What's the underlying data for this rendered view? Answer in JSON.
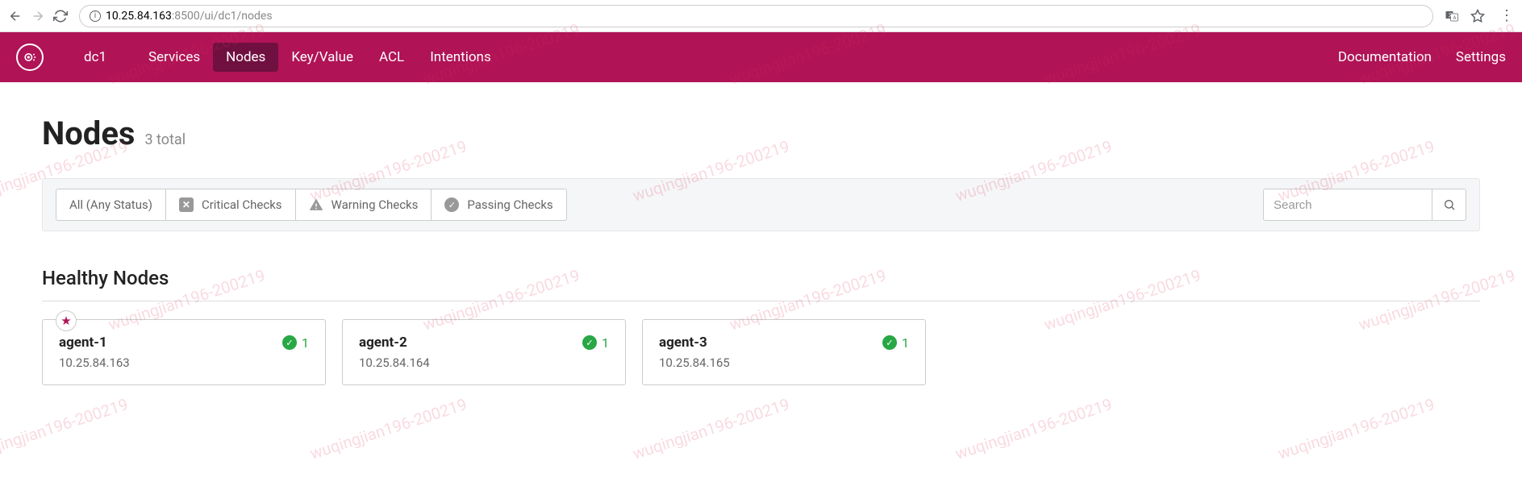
{
  "browser": {
    "url_host": "10.25.84.163",
    "url_path": ":8500/ui/dc1/nodes"
  },
  "nav": {
    "datacenter": "dc1",
    "items": [
      "Services",
      "Nodes",
      "Key/Value",
      "ACL",
      "Intentions"
    ],
    "active": "Nodes",
    "right": [
      "Documentation",
      "Settings"
    ]
  },
  "page": {
    "title": "Nodes",
    "subtitle": "3 total"
  },
  "filters": {
    "all": "All (Any Status)",
    "critical": "Critical Checks",
    "warning": "Warning Checks",
    "passing": "Passing Checks",
    "search_placeholder": "Search"
  },
  "section": {
    "title": "Healthy Nodes"
  },
  "nodes": [
    {
      "name": "agent-1",
      "ip": "10.25.84.163",
      "passing": 1,
      "leader": true
    },
    {
      "name": "agent-2",
      "ip": "10.25.84.164",
      "passing": 1,
      "leader": false
    },
    {
      "name": "agent-3",
      "ip": "10.25.84.165",
      "passing": 1,
      "leader": false
    }
  ],
  "watermark": "wuqingjian196-200219"
}
